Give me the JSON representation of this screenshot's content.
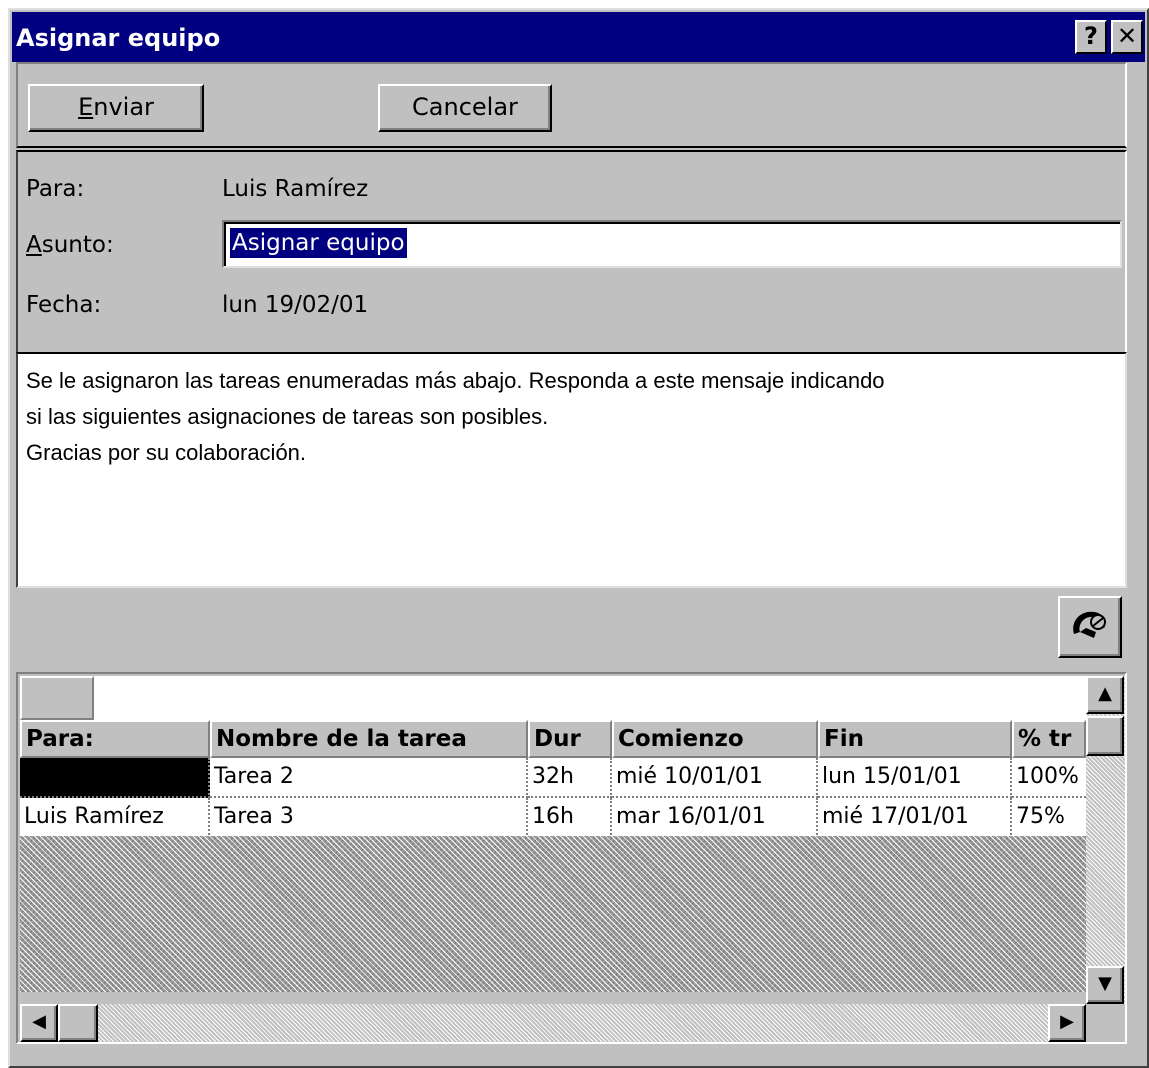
{
  "window": {
    "title": "Asignar equipo",
    "help_glyph": "?",
    "close_glyph": "✕"
  },
  "toolbar": {
    "send_label": "Enviar",
    "send_accesskey_letter": "E",
    "send_rest": "nviar",
    "cancel_label": "Cancelar"
  },
  "header": {
    "to_label": "Para:",
    "to_value": "Luis Ramírez",
    "subject_label": "Asunto:",
    "subject_accesskey_letter": "A",
    "subject_label_rest": "sunto:",
    "subject_value": "Asignar equipo",
    "date_label": "Fecha:",
    "date_value": "lun 19/02/01"
  },
  "message": {
    "lines": [
      "Se le asignaron las tareas enumeradas más abajo. Responda a este mensaje indicando",
      "si las siguientes asignaciones de tareas son posibles.",
      "Gracias por su colaboración."
    ]
  },
  "grid": {
    "columns": [
      "Para:",
      "Nombre de la tarea",
      "Dur",
      "Comienzo",
      "Fin",
      "% tr"
    ],
    "rows": [
      {
        "to": "",
        "task": "Tarea 2",
        "dur": "32h",
        "start": "mié 10/01/01",
        "end": "lun 15/01/01",
        "pct": "100%"
      },
      {
        "to": "Luis Ramírez",
        "task": "Tarea 3",
        "dur": "16h",
        "start": "mar 16/01/01",
        "end": "mié 17/01/01",
        "pct": "75%"
      }
    ],
    "scroll_up": "▲",
    "scroll_down": "▼",
    "scroll_left": "◀",
    "scroll_right": "▶"
  },
  "icons": {
    "address_book": "address-book-icon"
  },
  "colors": {
    "titlebar": "#000080",
    "face": "#c0c0c0",
    "selection": "#000080"
  }
}
